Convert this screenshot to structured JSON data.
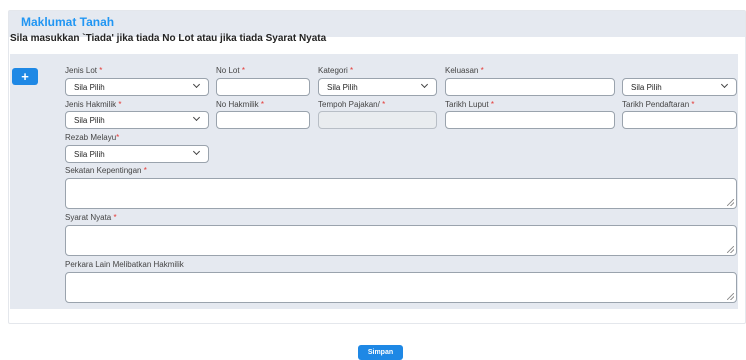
{
  "section": {
    "title": "Maklumat Tanah"
  },
  "note": "Sila masukkan `Tiada' jika tiada No Lot atau jika tiada Syarat Nyata",
  "add_button": "+",
  "required_mark": "*",
  "row1": {
    "jenis_lot": {
      "label": "Jenis Lot",
      "value": "Sila Pilih"
    },
    "no_lot": {
      "label": "No Lot",
      "value": ""
    },
    "kategori": {
      "label": "Kategori",
      "value": "Sila Pilih"
    },
    "keluasan": {
      "label": "Keluasan",
      "value": ""
    },
    "keluasan_unit": {
      "value": "Sila Pilih"
    }
  },
  "row2": {
    "jenis_hakmilik": {
      "label": "Jenis Hakmilik",
      "value": "Sila Pilih"
    },
    "no_hakmilik": {
      "label": "No Hakmilik",
      "value": ""
    },
    "tempoh_pajakan": {
      "label": "Tempoh Pajakan/",
      "value": ""
    },
    "tarikh_luput": {
      "label": "Tarikh Luput",
      "value": ""
    },
    "tarikh_pendaftaran": {
      "label": "Tarikh Pendaftaran",
      "value": ""
    }
  },
  "row3": {
    "rezab_melayu": {
      "label": "Rezab Melayu",
      "value": "Sila Pilih"
    }
  },
  "sekatan": {
    "label": "Sekatan Kepentingan"
  },
  "syarat": {
    "label": "Syarat Nyata"
  },
  "perkara": {
    "label": "Perkara Lain Melibatkan Hakmilik"
  },
  "save_button": "Simpan"
}
